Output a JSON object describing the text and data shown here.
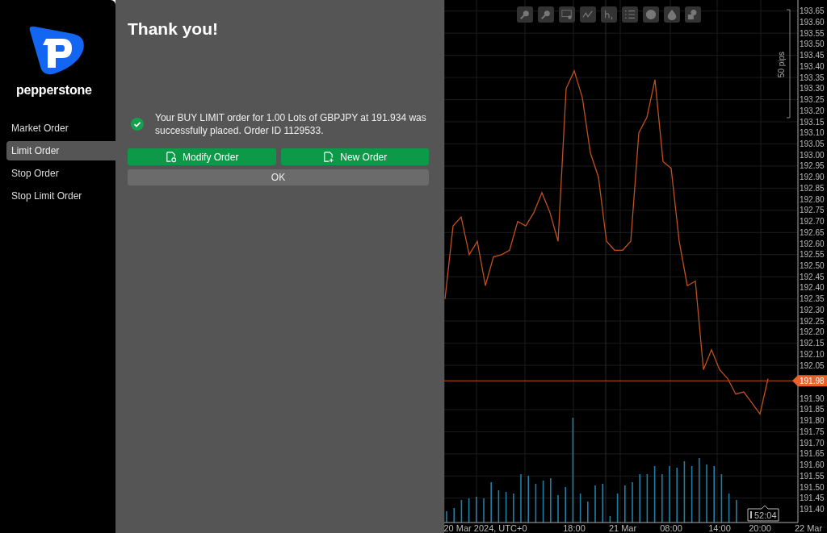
{
  "sidebar": {
    "brand": "pepperstone",
    "items": [
      {
        "label": "Market Order",
        "selected": false
      },
      {
        "label": "Limit Order",
        "selected": true
      },
      {
        "label": "Stop Order",
        "selected": false
      },
      {
        "label": "Stop Limit Order",
        "selected": false
      }
    ]
  },
  "dialog": {
    "title": "Thank you!",
    "message": "Your BUY LIMIT order for 1.00 Lots of GBPJPY at 191.934 was successfully placed. Order ID 1129533.",
    "buttons": [
      {
        "label": "Modify Order",
        "kind": "modify"
      },
      {
        "label": "New Order",
        "kind": "new"
      }
    ],
    "ok": "OK"
  },
  "chart": {
    "range_label": "50 pips",
    "time_box": "52:04",
    "chart_data": {
      "type": "line",
      "categories": [
        null,
        null,
        null,
        null,
        null,
        "20 Mar 2024, UTC+0",
        null,
        null,
        null,
        null,
        null,
        null,
        null,
        null,
        null,
        null,
        "18:00",
        null,
        null,
        null,
        null,
        null,
        "21 Mar",
        null,
        null,
        null,
        null,
        null,
        "08:00",
        null,
        null,
        null,
        null,
        null,
        "14:00",
        null,
        null,
        null,
        null,
        "20:00",
        null,
        null,
        null,
        null,
        null,
        "22 Mar"
      ],
      "series": [
        {
          "color": "#c0501e",
          "values": [
            192.35,
            192.68,
            192.72,
            192.55,
            192.61,
            192.41,
            192.54,
            192.55,
            192.57,
            192.7,
            192.68,
            192.74,
            192.83,
            192.74,
            192.61,
            193.3,
            193.38,
            193.26,
            193.01,
            192.9,
            192.61,
            192.57,
            192.57,
            192.61,
            193.1,
            193.17,
            193.34,
            192.97,
            192.94,
            192.61,
            192.41,
            192.43,
            192.03,
            192.12,
            192.03,
            191.99,
            191.92,
            191.93,
            191.88,
            191.83,
            191.99,
            null,
            null,
            null,
            null,
            null
          ]
        }
      ],
      "ylim": [
        191.34,
        193.7
      ],
      "grid": true,
      "ref_lines": [
        {
          "axis": "y",
          "value": 191.98,
          "label": "191.98",
          "color": "#c0501e"
        }
      ],
      "yticks": [
        {
          "value": 193.65,
          "label": "193.65"
        },
        {
          "value": 193.6,
          "label": "193.60"
        },
        {
          "value": 193.55,
          "label": "193.55"
        },
        {
          "value": 193.5,
          "label": "193.50"
        },
        {
          "value": 193.45,
          "label": "193.45"
        },
        {
          "value": 193.4,
          "label": "193.40"
        },
        {
          "value": 193.35,
          "label": "193.35"
        },
        {
          "value": 193.3,
          "label": "193.30"
        },
        {
          "value": 193.25,
          "label": "193.25"
        },
        {
          "value": 193.2,
          "label": "193.20"
        },
        {
          "value": 193.15,
          "label": "193.15"
        },
        {
          "value": 193.1,
          "label": "193.10"
        },
        {
          "value": 193.05,
          "label": "193.05"
        },
        {
          "value": 193,
          "label": "193.00"
        },
        {
          "value": 192.95,
          "label": "192.95"
        },
        {
          "value": 192.9,
          "label": "192.90"
        },
        {
          "value": 192.85,
          "label": "192.85"
        },
        {
          "value": 192.8,
          "label": "192.80"
        },
        {
          "value": 192.75,
          "label": "192.75"
        },
        {
          "value": 192.7,
          "label": "192.70"
        },
        {
          "value": 192.65,
          "label": "192.65"
        },
        {
          "value": 192.6,
          "label": "192.60"
        },
        {
          "value": 192.55,
          "label": "192.55"
        },
        {
          "value": 192.5,
          "label": "192.50"
        },
        {
          "value": 192.45,
          "label": "192.45"
        },
        {
          "value": 192.4,
          "label": "192.40"
        },
        {
          "value": 192.35,
          "label": "192.35"
        },
        {
          "value": 192.3,
          "label": "192.30"
        },
        {
          "value": 192.25,
          "label": "192.25"
        },
        {
          "value": 192.2,
          "label": "192.20"
        },
        {
          "value": 192.15,
          "label": "192.15"
        },
        {
          "value": 192.1,
          "label": "192.10"
        },
        {
          "value": 192.05,
          "label": "192.05"
        },
        {
          "value": 191.9,
          "label": "191.90"
        },
        {
          "value": 191.85,
          "label": "191.85"
        },
        {
          "value": 191.8,
          "label": "191.80"
        },
        {
          "value": 191.75,
          "label": "191.75"
        },
        {
          "value": 191.7,
          "label": "191.70"
        },
        {
          "value": 191.65,
          "label": "191.65"
        },
        {
          "value": 191.6,
          "label": "191.60"
        },
        {
          "value": 191.55,
          "label": "191.55"
        },
        {
          "value": 191.5,
          "label": "191.50"
        },
        {
          "value": 191.45,
          "label": "191.45"
        },
        {
          "value": 191.4,
          "label": "191.40"
        }
      ]
    }
  }
}
